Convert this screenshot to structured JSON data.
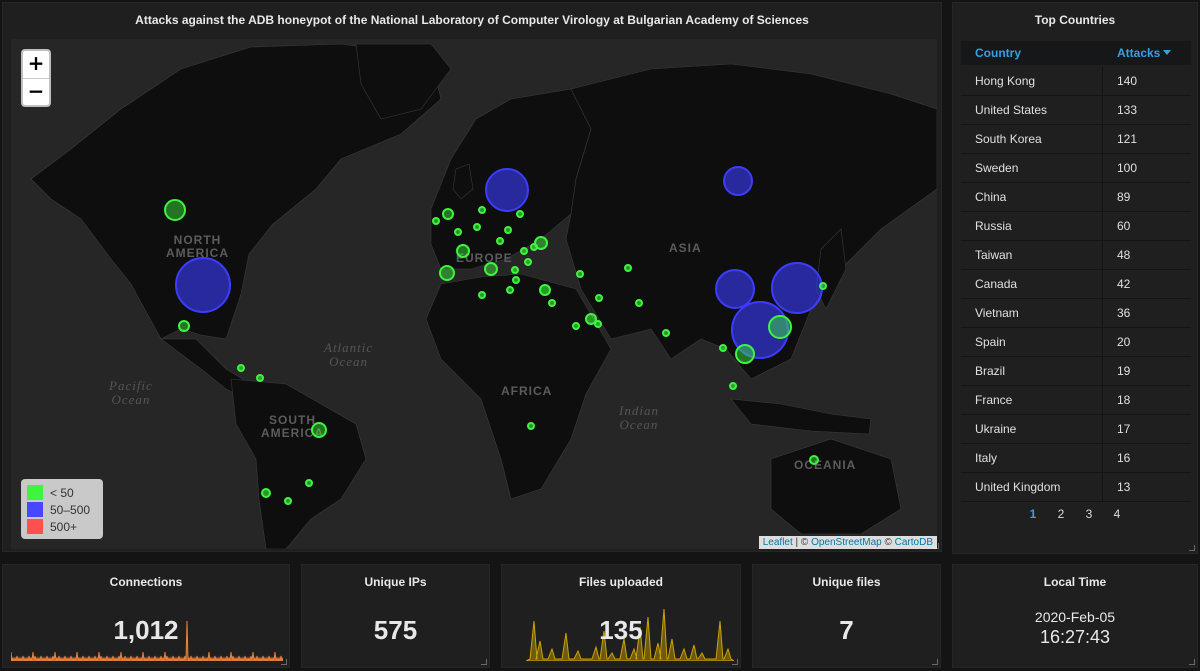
{
  "map_panel": {
    "title": "Attacks against the ADB honeypot of the National Laboratory of Computer Virology at Bulgarian Academy of Sciences",
    "zoom_in": "+",
    "zoom_out": "−",
    "legend": [
      {
        "label": "< 50",
        "color": "#3ef43e"
      },
      {
        "label": "50–500",
        "color": "#4747ff"
      },
      {
        "label": "500+",
        "color": "#ff4f4f"
      }
    ],
    "attribution": {
      "leaflet": "Leaflet",
      "sep1": " | © ",
      "osm": "OpenStreetMap",
      "sep2": " © ",
      "carto": "CartoDB"
    },
    "labels": {
      "north_america": "NORTH\nAMERICA",
      "south_america": "SOUTH\nAMERICA",
      "europe": "EUROPE",
      "asia": "ASIA",
      "africa": "AFRICA",
      "oceania": "OCEANIA",
      "atlantic": "Atlantic\nOcean",
      "pacific": "Pacific\nOcean",
      "indian": "Indian\nOcean"
    }
  },
  "countries_panel": {
    "title": "Top Countries",
    "col_country": "Country",
    "col_attacks": "Attacks",
    "rows": [
      {
        "country": "Hong Kong",
        "attacks": "140"
      },
      {
        "country": "United States",
        "attacks": "133"
      },
      {
        "country": "South Korea",
        "attacks": "121"
      },
      {
        "country": "Sweden",
        "attacks": "100"
      },
      {
        "country": "China",
        "attacks": "89"
      },
      {
        "country": "Russia",
        "attacks": "60"
      },
      {
        "country": "Taiwan",
        "attacks": "48"
      },
      {
        "country": "Canada",
        "attacks": "42"
      },
      {
        "country": "Vietnam",
        "attacks": "36"
      },
      {
        "country": "Spain",
        "attacks": "20"
      },
      {
        "country": "Brazil",
        "attacks": "19"
      },
      {
        "country": "France",
        "attacks": "18"
      },
      {
        "country": "Ukraine",
        "attacks": "17"
      },
      {
        "country": "Italy",
        "attacks": "16"
      },
      {
        "country": "United Kingdom",
        "attacks": "13"
      }
    ],
    "pages": [
      "1",
      "2",
      "3",
      "4"
    ],
    "active_page": "1"
  },
  "stats": {
    "connections": {
      "title": "Connections",
      "value": "1,012",
      "color": "#ef843c"
    },
    "unique_ips": {
      "title": "Unique IPs",
      "value": "575"
    },
    "files_uploaded": {
      "title": "Files uploaded",
      "value": "135",
      "color": "#cca300"
    },
    "unique_files": {
      "title": "Unique files",
      "value": "7"
    }
  },
  "local_time": {
    "title": "Local Time",
    "date": "2020-Feb-05",
    "time": "16:27:43"
  }
}
